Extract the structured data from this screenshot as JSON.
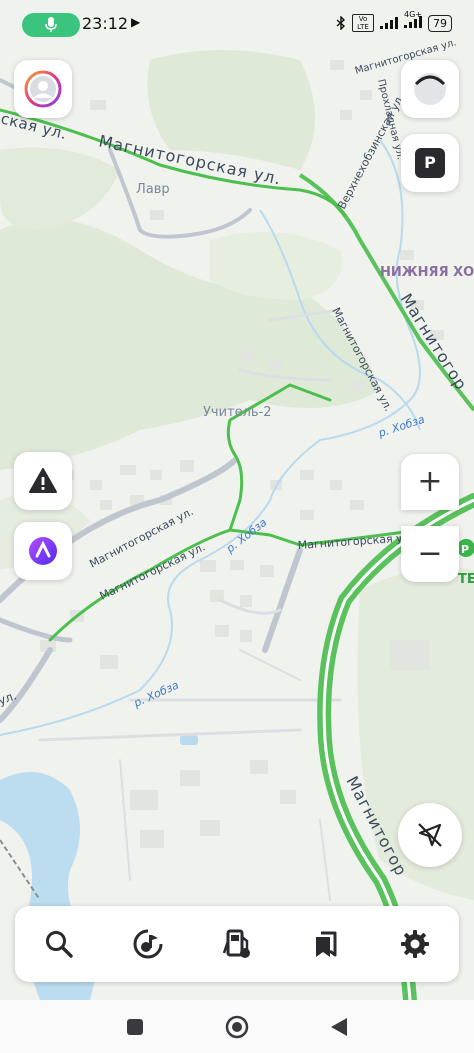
{
  "status_bar": {
    "time": "23:12",
    "nav_glyph": "▶",
    "network": "4G+",
    "volte": "Vo LTE",
    "battery": "79"
  },
  "map": {
    "street_labels": [
      "ская ул.",
      "Магнитогорская ул.",
      "Магнитогорская ул.",
      "Магнитогорская ул.",
      "Магнитогорская ул.",
      "Магнитогорская ул.",
      "ул.",
      "Магнитогор",
      "Магнитогор",
      "Верхнехобзинская ул."
    ],
    "street_fragments": [
      "Магнитогорская ул.",
      "Прохладная ул."
    ],
    "place_labels": [
      "Лавр",
      "Учитель-2",
      "НИЖНЯЯ ХО"
    ],
    "river_labels": [
      "р. Хобза",
      "р. Хобза",
      "р. Хобза"
    ],
    "misc_label": "ТЕ"
  },
  "controls": {
    "parking_label": "P",
    "zoom_in": "+",
    "zoom_out": "−"
  },
  "icons": {
    "profile": "avatar-icon",
    "compass": "compass-icon",
    "alert": "warning-icon",
    "alice": "alice-icon",
    "location": "location-off-icon",
    "search": "search-icon",
    "music": "music-icon",
    "fuel": "fuel-icon",
    "bookmarks": "bookmarks-icon",
    "settings": "gear-icon"
  },
  "colors": {
    "route_green": "#4cbf4f",
    "road_gray": "#b5bcc6",
    "water": "#b8d9ee",
    "forest": "#dde8d6",
    "mic_green": "#3ac47d",
    "alice_purple": "#7b3ff2"
  }
}
